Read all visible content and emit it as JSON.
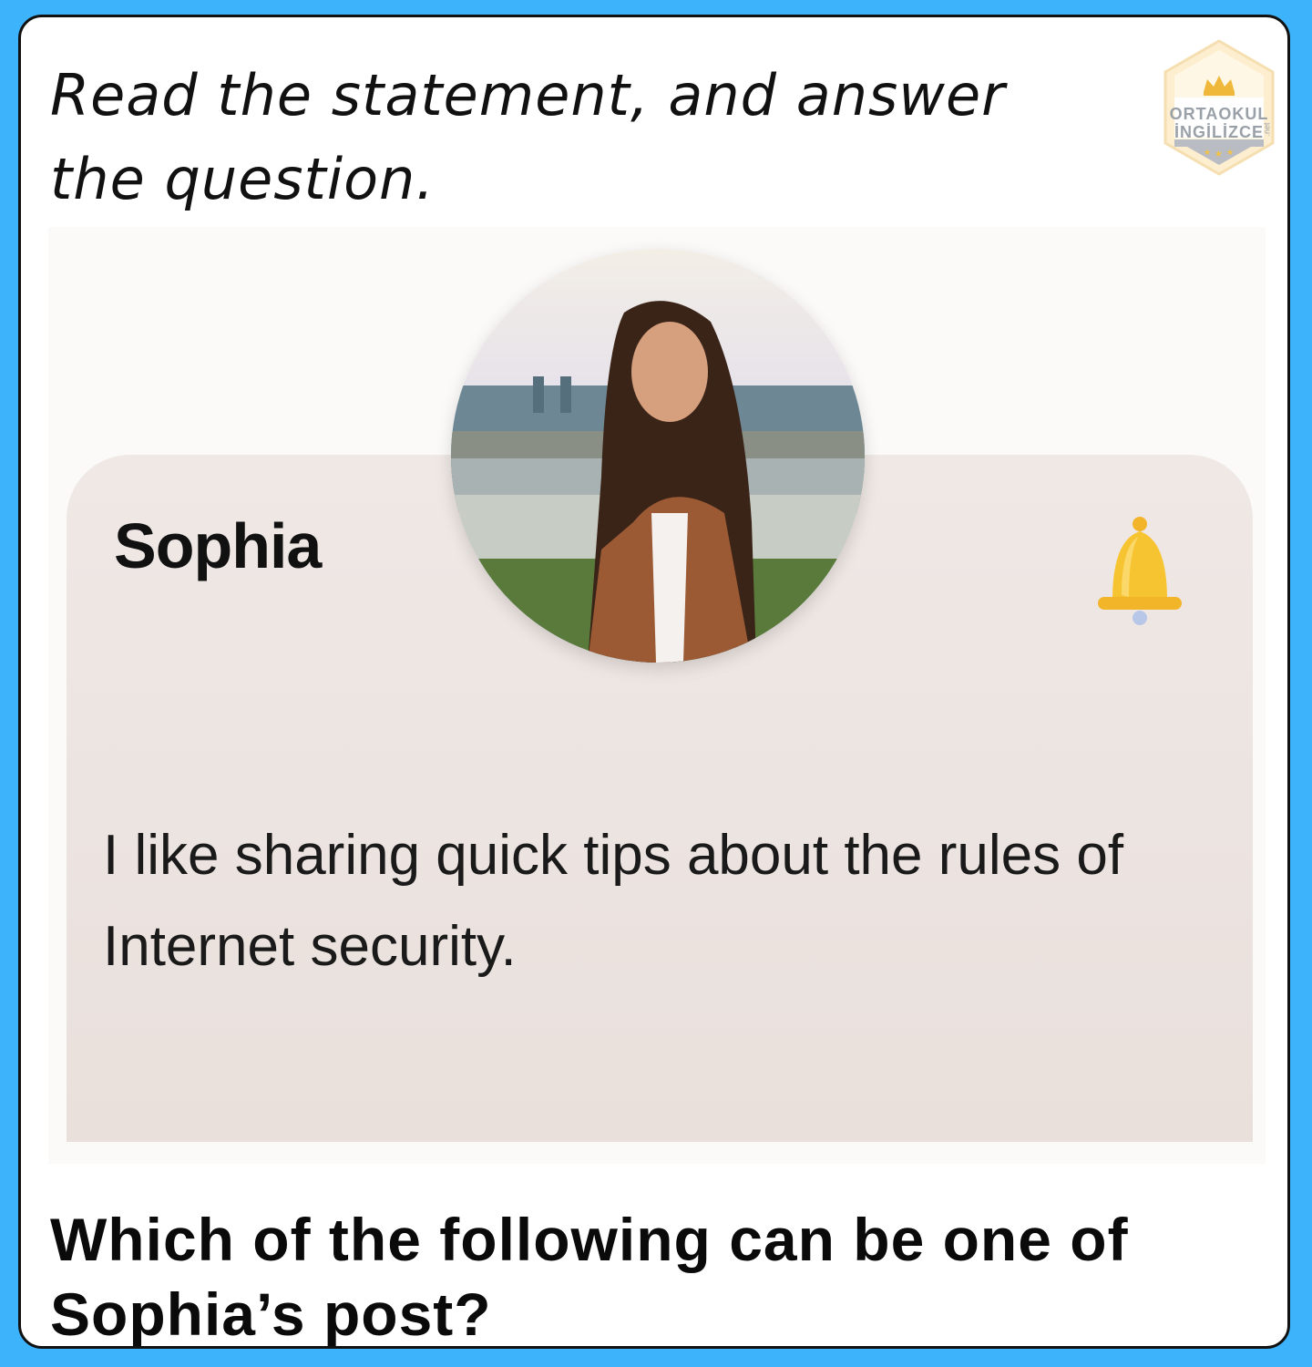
{
  "instruction": "Read the statement, and answer the question.",
  "logo": {
    "line1": "ORTAOKUL",
    "line2": "İNGİLİZCE",
    "suffix": ".net",
    "icon": "crown-hexagon-logo"
  },
  "card": {
    "name": "Sophia",
    "statement": "I like sharing quick tips about the rules of Internet security.",
    "avatar": "profile-photo",
    "bell_icon": "bell-icon"
  },
  "question": "Which of the following can be one of Sophia’s post?",
  "colors": {
    "background": "#3db3fb",
    "frame": "#ffffff",
    "card": "#ece4e1",
    "bell": "#f7c431"
  }
}
